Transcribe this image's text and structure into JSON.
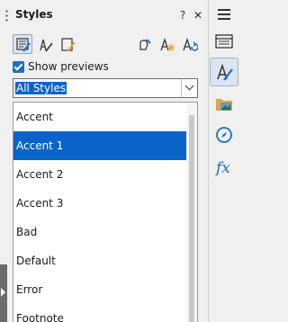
{
  "panel": {
    "title": "Styles",
    "help_label": "?",
    "close_label": "✕",
    "menu_label": "☰"
  },
  "toolbar": {
    "buttons": [
      {
        "name": "paragraph-styles",
        "active": true
      },
      {
        "name": "character-styles",
        "active": false
      },
      {
        "name": "frame-styles",
        "active": false
      },
      {
        "name": "fill-format-mode",
        "active": false
      },
      {
        "name": "new-style-from-selection",
        "active": false
      },
      {
        "name": "update-style",
        "active": false
      }
    ]
  },
  "show_previews": {
    "label": "Show previews",
    "checked": true
  },
  "filter": {
    "selected": "All Styles"
  },
  "styles": {
    "items": [
      {
        "label": "Accent",
        "selected": false
      },
      {
        "label": "Accent 1",
        "selected": true
      },
      {
        "label": "Accent 2",
        "selected": false
      },
      {
        "label": "Accent 3",
        "selected": false
      },
      {
        "label": "Bad",
        "selected": false
      },
      {
        "label": "Default",
        "selected": false
      },
      {
        "label": "Error",
        "selected": false
      },
      {
        "label": "Footnote",
        "selected": false
      }
    ]
  },
  "sidebar": {
    "tabs": [
      {
        "name": "properties",
        "active": false
      },
      {
        "name": "styles",
        "active": true
      },
      {
        "name": "gallery",
        "active": false
      },
      {
        "name": "navigator",
        "active": false
      },
      {
        "name": "functions",
        "active": false
      }
    ]
  },
  "colors": {
    "accent": "#0a64c8",
    "icon_blue": "#1f6fbf",
    "icon_orange": "#e8a33b"
  }
}
